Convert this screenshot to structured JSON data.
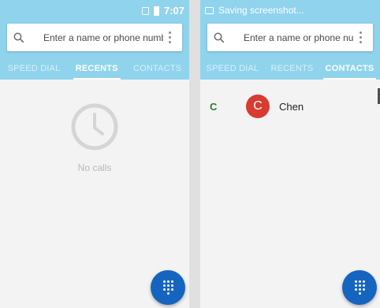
{
  "left_screen": {
    "status": {
      "time": "7:07",
      "icons": [
        "sim-icon",
        "battery-icon"
      ]
    },
    "search": {
      "placeholder": "Enter a name or phone number",
      "search_icon": "search-icon",
      "menu_icon": "more-vert-icon"
    },
    "tabs": [
      {
        "label": "SPEED DIAL",
        "active": false
      },
      {
        "label": "RECENTS",
        "active": true
      },
      {
        "label": "CONTACTS",
        "active": false
      }
    ],
    "empty_state": {
      "icon": "clock-icon",
      "message": "No calls"
    },
    "fab_icon": "dialpad-icon"
  },
  "right_screen": {
    "status": {
      "notification": "Saving screenshot...",
      "icons": [
        "screenshot-icon"
      ]
    },
    "search": {
      "placeholder": "Enter a name or phone number",
      "search_icon": "search-icon",
      "menu_icon": "more-vert-icon"
    },
    "tabs": [
      {
        "label": "SPEED DIAL",
        "active": false
      },
      {
        "label": "RECENTS",
        "active": false
      },
      {
        "label": "CONTACTS",
        "active": true
      }
    ],
    "contacts": [
      {
        "section": "C",
        "avatar_letter": "C",
        "name": "Chen"
      }
    ],
    "fab_icon": "dialpad-icon"
  },
  "colors": {
    "header_bg": "#90d3ec",
    "fab": "#1565c0",
    "avatar": "#d83b30",
    "section_letter": "#2e7d32"
  }
}
